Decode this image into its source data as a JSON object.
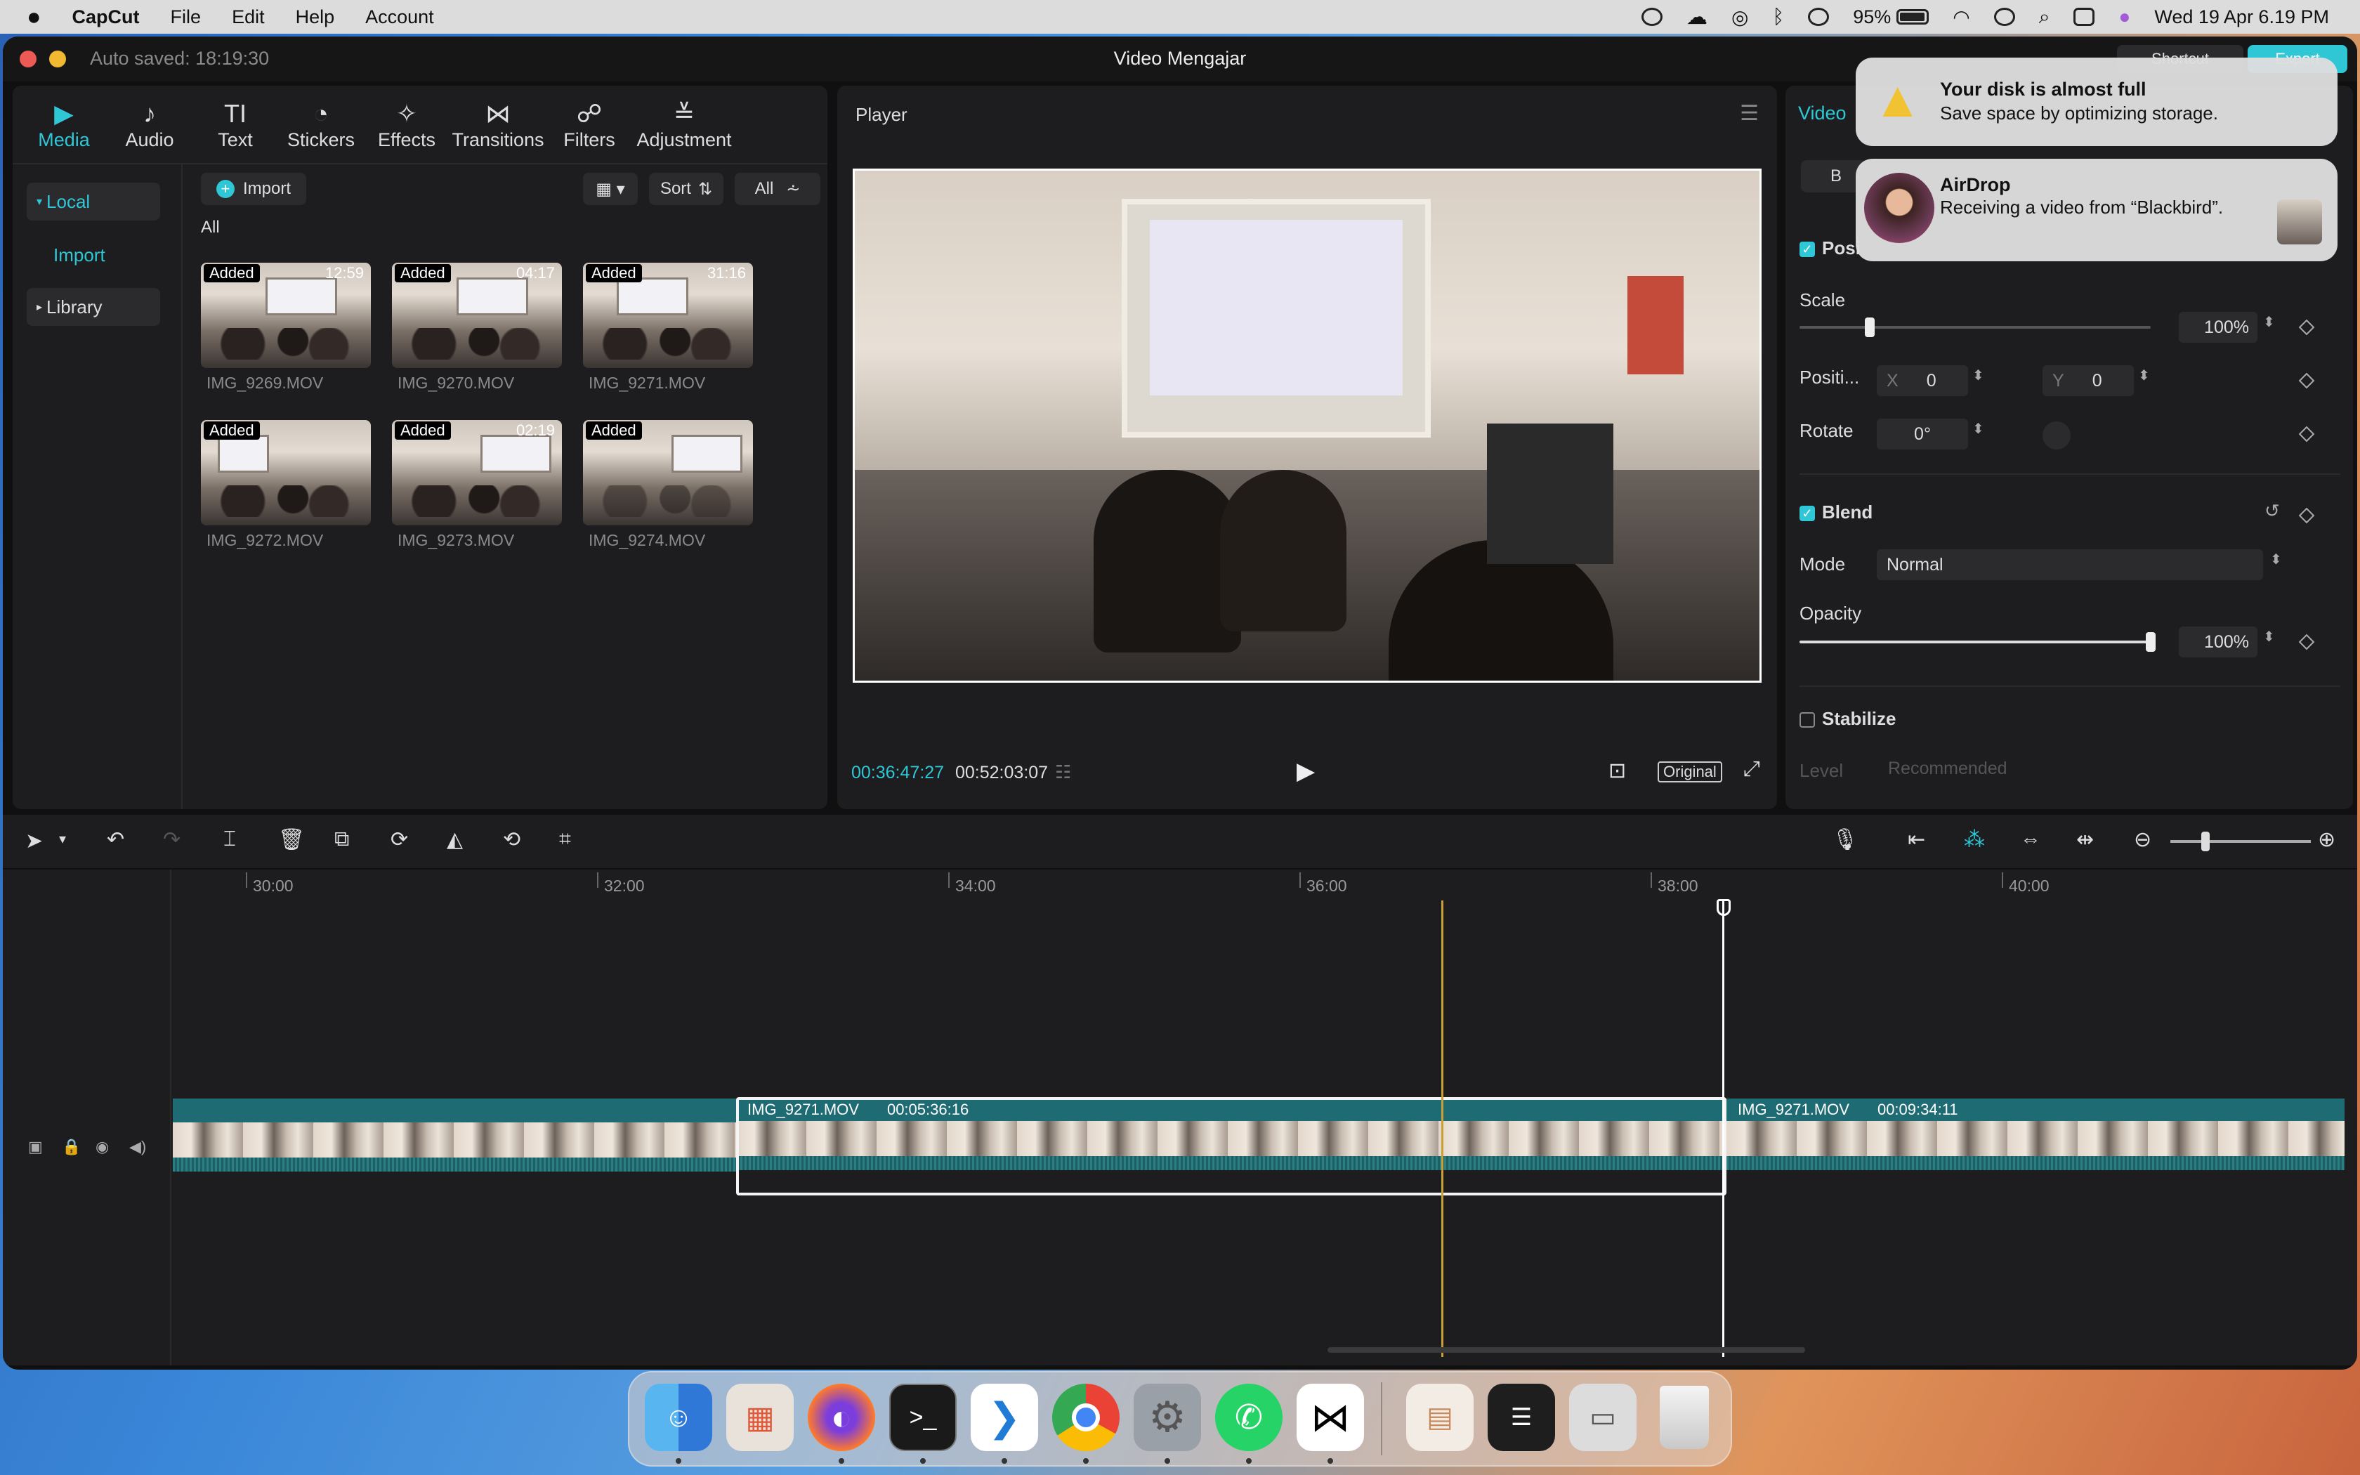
{
  "menubar": {
    "app_name": "CapCut",
    "menus": [
      "File",
      "Edit",
      "Help",
      "Account"
    ],
    "battery": "95%",
    "datetime": "Wed 19 Apr  6.19 PM"
  },
  "window": {
    "auto_saved": "Auto saved: 18:19:30",
    "title": "Video Mengajar",
    "export_label": "Export",
    "shortcut_label": "Shortcut"
  },
  "toolbar": {
    "items": [
      {
        "label": "Media",
        "icon": "media-icon",
        "glyph": "▶"
      },
      {
        "label": "Audio",
        "icon": "audio-icon",
        "glyph": "♪"
      },
      {
        "label": "Text",
        "icon": "text-icon",
        "glyph": "TI"
      },
      {
        "label": "Stickers",
        "icon": "stickers-icon",
        "glyph": "◔"
      },
      {
        "label": "Effects",
        "icon": "effects-icon",
        "glyph": "✧"
      },
      {
        "label": "Transitions",
        "icon": "transitions-icon",
        "glyph": "⋈"
      },
      {
        "label": "Filters",
        "icon": "filters-icon",
        "glyph": "☍"
      },
      {
        "label": "Adjustment",
        "icon": "adjustment-icon",
        "glyph": "≚"
      }
    ]
  },
  "media": {
    "side": {
      "local": "Local",
      "import": "Import",
      "library": "Library"
    },
    "import_button": "Import",
    "sort_label": "Sort",
    "all_filter": "All",
    "all_heading": "All",
    "items": [
      {
        "name": "IMG_9269.MOV",
        "badge": "Added",
        "duration": "12:59"
      },
      {
        "name": "IMG_9270.MOV",
        "badge": "Added",
        "duration": "04:17"
      },
      {
        "name": "IMG_9271.MOV",
        "badge": "Added",
        "duration": "31:16"
      },
      {
        "name": "IMG_9272.MOV",
        "badge": "Added",
        "duration": ""
      },
      {
        "name": "IMG_9273.MOV",
        "badge": "Added",
        "duration": "02:19"
      },
      {
        "name": "IMG_9274.MOV",
        "badge": "Added",
        "duration": ""
      }
    ]
  },
  "player": {
    "title": "Player",
    "current_time": "00:36:47:27",
    "total_time": "00:52:03:07",
    "ratio_label": "Original"
  },
  "properties": {
    "tab": "Video",
    "basic_tab": "B",
    "position_section": "Posi",
    "scale_label": "Scale",
    "scale_value": "100%",
    "scale_fraction": 0.2,
    "position_label": "Positi...",
    "x_label": "X",
    "x_value": "0",
    "y_label": "Y",
    "y_value": "0",
    "rotate_label": "Rotate",
    "rotate_value": "0°",
    "blend_label": "Blend",
    "mode_label": "Mode",
    "mode_value": "Normal",
    "opacity_label": "Opacity",
    "opacity_value": "100%",
    "opacity_fraction": 1.0,
    "stabilize_label": "Stabilize",
    "level_label": "Level",
    "level_value": "Recommended"
  },
  "notifications": {
    "disk": {
      "title": "Your disk is almost full",
      "body": "Save space by optimizing storage."
    },
    "airdrop": {
      "title": "AirDrop",
      "body": "Receiving a video from “Blackbird”."
    }
  },
  "timeline": {
    "ticks": [
      "30:00",
      "32:00",
      "34:00",
      "36:00",
      "38:00",
      "40:00"
    ],
    "clips": [
      {
        "name": "IMG_9271.MOV",
        "duration": "00:05:36:16"
      },
      {
        "name": "IMG_9271.MOV",
        "duration": "00:09:34:11"
      }
    ]
  },
  "dock": {
    "apps": [
      "Finder",
      "Launchpad",
      "Firefox",
      "Terminal",
      "Visual Studio Code",
      "Chrome",
      "System Settings",
      "WhatsApp",
      "CapCut"
    ]
  }
}
